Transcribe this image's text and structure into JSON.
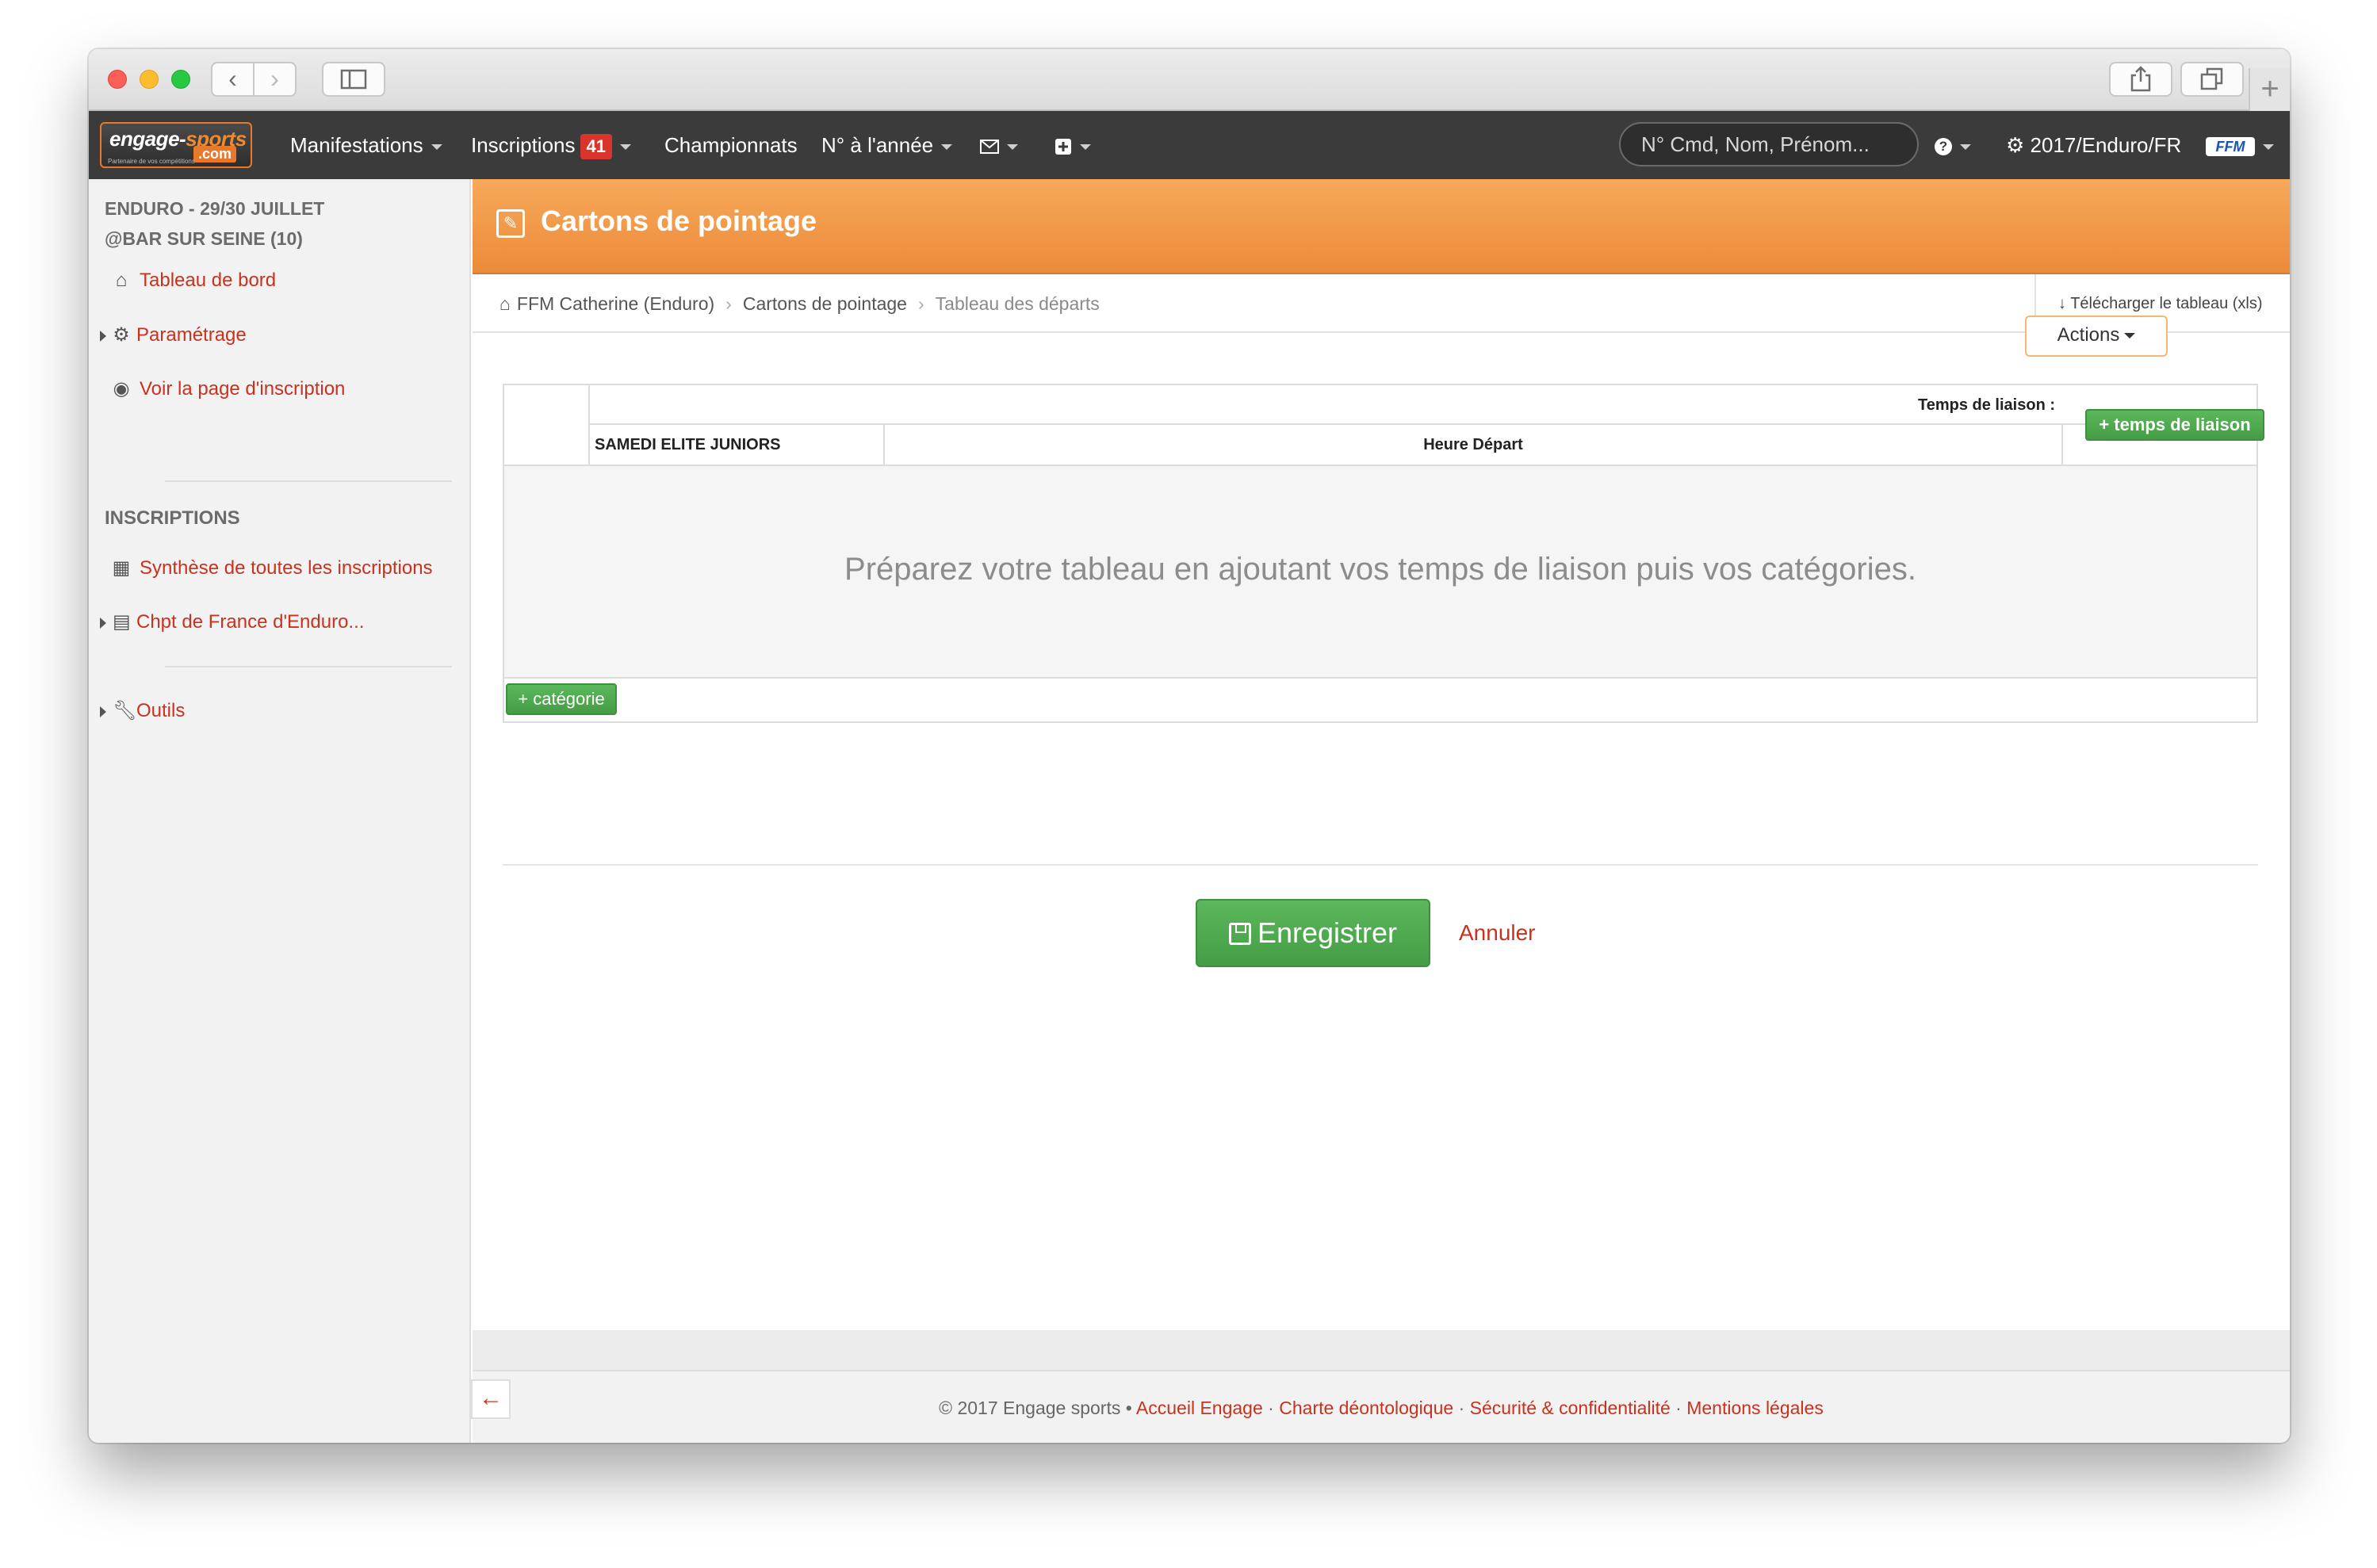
{
  "browser": {
    "back_icon": "chevron-left-icon",
    "forward_icon": "chevron-right-icon",
    "sidebar_icon": "sidebar-icon",
    "share_icon": "share-icon",
    "tabs_icon": "tabs-icon",
    "new_tab_label": "+"
  },
  "navbar": {
    "logo_main": "engage-",
    "logo_accent": "sports",
    "logo_tld": ".com",
    "logo_tagline": "Partenaire de vos compétitions",
    "items": [
      {
        "label": "Manifestations"
      },
      {
        "label": "Inscriptions",
        "badge": "41"
      },
      {
        "label": "Championnats"
      },
      {
        "label": "N° à l'année"
      }
    ],
    "mail_icon": "envelope-icon",
    "plus_icon": "plus-square-icon",
    "search_placeholder": "N° Cmd, Nom, Prénom...",
    "help_icon": "question-icon",
    "settings_label": "2017/Enduro/FR",
    "settings_icon": "gear-icon",
    "ffm_logo": "FFM",
    "colors": {
      "bg": "#3b3b3b",
      "badge": "#d9342b",
      "brand": "#e8792b"
    }
  },
  "sidebar": {
    "event_title_line1": "ENDURO - 29/30 JUILLET",
    "event_title_line2": "@BAR SUR SEINE (10)",
    "items": [
      {
        "label": "Tableau de bord",
        "icon": "home-icon"
      },
      {
        "label": "Paramétrage",
        "icon": "gear-icon"
      },
      {
        "label": "Voir la page d'inscription",
        "icon": "eye-icon"
      }
    ],
    "section_inscriptions": "INSCRIPTIONS",
    "inscriptions_items": [
      {
        "label": "Synthèse de toutes les inscriptions",
        "icon": "table-icon"
      },
      {
        "label": "Chpt de France d'Enduro...",
        "icon": "calendar-icon"
      }
    ],
    "tools_label": "Outils",
    "tools_icon": "wrench-icon"
  },
  "page": {
    "title": "Cartons de pointage",
    "title_icon": "edit-icon",
    "breadcrumb": [
      "FFM Catherine (Enduro)",
      "Cartons de pointage",
      "Tableau des départs"
    ],
    "breadcrumb_icon": "home-icon",
    "download_label": "Télécharger le tableau (xls)",
    "actions_label": "Actions",
    "accent": "#ec8b3a"
  },
  "grid": {
    "liaison_label": "Temps de liaison :",
    "add_liaison_label": "+ temps de liaison",
    "category_header": "SAMEDI ELITE JUNIORS",
    "depart_header": "Heure Départ",
    "empty_message": "Préparez votre tableau en ajoutant vos temps de liaison puis vos catégories.",
    "add_category_label": "+ catégorie"
  },
  "form": {
    "save_label": "Enregistrer",
    "cancel_label": "Annuler"
  },
  "footer": {
    "copyright": "© 2017 Engage sports •",
    "links": [
      "Accueil Engage",
      "Charte déontologique",
      "Sécurité & confidentialité",
      "Mentions légales"
    ],
    "separator": "·"
  }
}
